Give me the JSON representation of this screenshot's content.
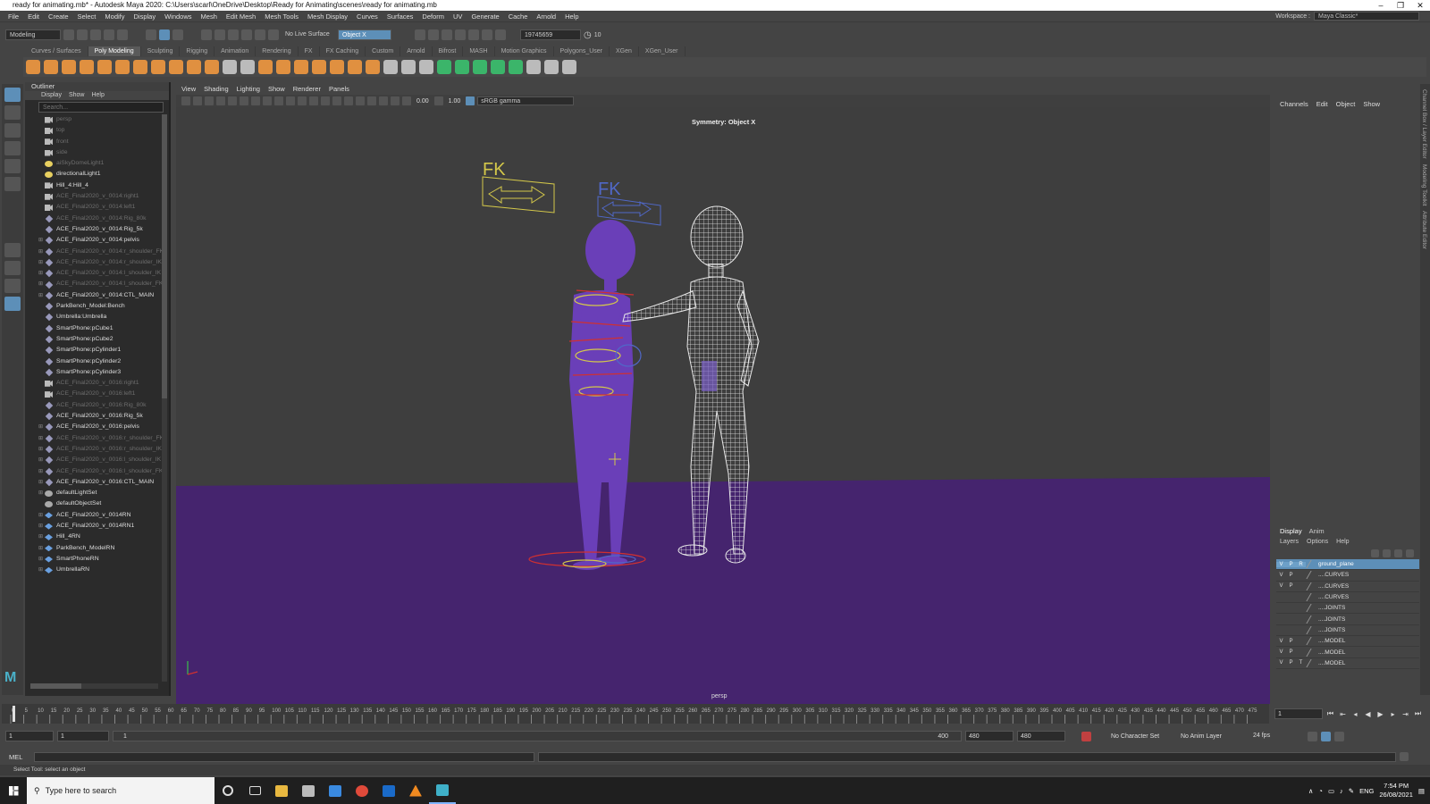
{
  "window": {
    "title": "ready for animating.mb* - Autodesk Maya 2020: C:\\Users\\scarl\\OneDrive\\Desktop\\Ready for Animating\\scenes\\ready for animating.mb",
    "min": "–",
    "max": "❐",
    "close": "✕"
  },
  "menubar": [
    "File",
    "Edit",
    "Create",
    "Select",
    "Modify",
    "Display",
    "Windows",
    "Mesh",
    "Edit Mesh",
    "Mesh Tools",
    "Mesh Display",
    "Curves",
    "Surfaces",
    "Deform",
    "UV",
    "Generate",
    "Cache",
    "Arnold",
    "Help"
  ],
  "workspace": {
    "label": "Workspace :",
    "value": "Maya Classic*"
  },
  "statusline": {
    "menuset": "Modeling",
    "live_surface": "No Live Surface",
    "symmetry": "Object X",
    "user_id": "19745659",
    "count": "10"
  },
  "shelf_tabs": [
    "Curves / Surfaces",
    "Poly Modeling",
    "Sculpting",
    "Rigging",
    "Animation",
    "Rendering",
    "FX",
    "FX Caching",
    "Custom",
    "Arnold",
    "Bifrost",
    "MASH",
    "Motion Graphics",
    "Polygons_User",
    "XGen",
    "XGen_User"
  ],
  "shelf_active": "Poly Modeling",
  "outliner": {
    "title": "Outliner",
    "menu": [
      "Display",
      "Show",
      "Help"
    ],
    "search_placeholder": "Search...",
    "items": [
      {
        "label": "persp",
        "icon": "cam",
        "dim": true,
        "exp": ""
      },
      {
        "label": "top",
        "icon": "cam",
        "dim": true,
        "exp": ""
      },
      {
        "label": "front",
        "icon": "cam",
        "dim": true,
        "exp": ""
      },
      {
        "label": "side",
        "icon": "cam",
        "dim": true,
        "exp": ""
      },
      {
        "label": "aiSkyDomeLight1",
        "icon": "lt",
        "dim": true,
        "exp": ""
      },
      {
        "label": "directionalLight1",
        "icon": "lt",
        "dim": false,
        "exp": ""
      },
      {
        "label": "Hill_4:Hill_4",
        "icon": "cam",
        "dim": false,
        "exp": ""
      },
      {
        "label": "ACE_Final2020_v_0014:right1",
        "icon": "cam",
        "dim": true,
        "exp": ""
      },
      {
        "label": "ACE_Final2020_v_0014:left1",
        "icon": "cam",
        "dim": true,
        "exp": ""
      },
      {
        "label": "ACE_Final2020_v_0014:Rig_80k",
        "icon": "xf",
        "dim": true,
        "exp": ""
      },
      {
        "label": "ACE_Final2020_v_0014:Rig_5k",
        "icon": "xf",
        "dim": false,
        "exp": ""
      },
      {
        "label": "ACE_Final2020_v_0014:pelvis",
        "icon": "xf",
        "dim": false,
        "exp": "⊞"
      },
      {
        "label": "ACE_Final2020_v_0014:r_shoulder_FK",
        "icon": "xf",
        "dim": true,
        "exp": "⊞"
      },
      {
        "label": "ACE_Final2020_v_0014:r_shoulder_IK",
        "icon": "xf",
        "dim": true,
        "exp": "⊞"
      },
      {
        "label": "ACE_Final2020_v_0014:l_shoulder_IK",
        "icon": "xf",
        "dim": true,
        "exp": "⊞"
      },
      {
        "label": "ACE_Final2020_v_0014:l_shoulder_FK",
        "icon": "xf",
        "dim": true,
        "exp": "⊞"
      },
      {
        "label": "ACE_Final2020_v_0014:CTL_MAIN",
        "icon": "xf",
        "dim": false,
        "exp": "⊞"
      },
      {
        "label": "ParkBench_Model:Bench",
        "icon": "xf",
        "dim": false,
        "exp": ""
      },
      {
        "label": "Umbrella:Umbrella",
        "icon": "xf",
        "dim": false,
        "exp": ""
      },
      {
        "label": "SmartPhone:pCube1",
        "icon": "xf",
        "dim": false,
        "exp": ""
      },
      {
        "label": "SmartPhone:pCube2",
        "icon": "xf",
        "dim": false,
        "exp": ""
      },
      {
        "label": "SmartPhone:pCylinder1",
        "icon": "xf",
        "dim": false,
        "exp": ""
      },
      {
        "label": "SmartPhone:pCylinder2",
        "icon": "xf",
        "dim": false,
        "exp": ""
      },
      {
        "label": "SmartPhone:pCylinder3",
        "icon": "xf",
        "dim": false,
        "exp": ""
      },
      {
        "label": "ACE_Final2020_v_0016:right1",
        "icon": "cam",
        "dim": true,
        "exp": ""
      },
      {
        "label": "ACE_Final2020_v_0016:left1",
        "icon": "cam",
        "dim": true,
        "exp": ""
      },
      {
        "label": "ACE_Final2020_v_0016:Rig_80k",
        "icon": "xf",
        "dim": true,
        "exp": ""
      },
      {
        "label": "ACE_Final2020_v_0016:Rig_5k",
        "icon": "xf",
        "dim": false,
        "exp": ""
      },
      {
        "label": "ACE_Final2020_v_0016:pelvis",
        "icon": "xf",
        "dim": false,
        "exp": "⊞"
      },
      {
        "label": "ACE_Final2020_v_0016:r_shoulder_FK",
        "icon": "xf",
        "dim": true,
        "exp": "⊞"
      },
      {
        "label": "ACE_Final2020_v_0016:r_shoulder_IK",
        "icon": "xf",
        "dim": true,
        "exp": "⊞"
      },
      {
        "label": "ACE_Final2020_v_0016:l_shoulder_IK",
        "icon": "xf",
        "dim": true,
        "exp": "⊞"
      },
      {
        "label": "ACE_Final2020_v_0016:l_shoulder_FK",
        "icon": "xf",
        "dim": true,
        "exp": "⊞"
      },
      {
        "label": "ACE_Final2020_v_0016:CTL_MAIN",
        "icon": "xf",
        "dim": false,
        "exp": "⊞"
      },
      {
        "label": "defaultLightSet",
        "icon": "set",
        "dim": false,
        "exp": "⊞"
      },
      {
        "label": "defaultObjectSet",
        "icon": "set",
        "dim": false,
        "exp": ""
      },
      {
        "label": "ACE_Final2020_v_0014RN",
        "icon": "ref",
        "dim": false,
        "exp": "⊞"
      },
      {
        "label": "ACE_Final2020_v_0014RN1",
        "icon": "ref",
        "dim": false,
        "exp": "⊞"
      },
      {
        "label": "Hill_4RN",
        "icon": "ref",
        "dim": false,
        "exp": "⊞"
      },
      {
        "label": "ParkBench_ModelRN",
        "icon": "ref",
        "dim": false,
        "exp": "⊞"
      },
      {
        "label": "SmartPhoneRN",
        "icon": "ref",
        "dim": false,
        "exp": "⊞"
      },
      {
        "label": "UmbrellaRN",
        "icon": "ref",
        "dim": false,
        "exp": "⊞"
      }
    ]
  },
  "viewport": {
    "menu": [
      "View",
      "Shading",
      "Lighting",
      "Show",
      "Renderer",
      "Panels"
    ],
    "exposure": "0.00",
    "gamma": "1.00",
    "color_space": "sRGB gamma",
    "symmetry_label": "Symmetry: Object X",
    "camera": "persp",
    "fk_label": "FK",
    "colors": {
      "floor": "#45246e",
      "bg": "#3e3e3e",
      "character": "#6a3fb8",
      "wire": "#e8e8e8"
    }
  },
  "channelbox": {
    "menu": [
      "Channels",
      "Edit",
      "Object",
      "Show"
    ]
  },
  "side_tabs": [
    "Channel Box / Layer Editor",
    "Modeling Toolkit",
    "Attribute Editor"
  ],
  "layers": {
    "tabs": [
      "Display",
      "Anim"
    ],
    "menu": [
      "Layers",
      "Options",
      "Help"
    ],
    "rows": [
      {
        "v": "V",
        "p": "P",
        "r": "R",
        "name": "ground_plane",
        "selected": true
      },
      {
        "v": "V",
        "p": "P",
        "r": "",
        "name": "....CURVES",
        "selected": false
      },
      {
        "v": "V",
        "p": "P",
        "r": "",
        "name": "....CURVES",
        "selected": false
      },
      {
        "v": "",
        "p": "",
        "r": "",
        "name": "....CURVES",
        "selected": false
      },
      {
        "v": "",
        "p": "",
        "r": "",
        "name": "....JOINTS",
        "selected": false
      },
      {
        "v": "",
        "p": "",
        "r": "",
        "name": "....JOINTS",
        "selected": false
      },
      {
        "v": "",
        "p": "",
        "r": "",
        "name": "....JOINTS",
        "selected": false
      },
      {
        "v": "V",
        "p": "P",
        "r": "",
        "name": "....MODEL",
        "selected": false
      },
      {
        "v": "V",
        "p": "P",
        "r": "",
        "name": "....MODEL",
        "selected": false
      },
      {
        "v": "V",
        "p": "P",
        "r": "T",
        "name": "....MODEL",
        "selected": false
      }
    ]
  },
  "timeslider": {
    "ticks": [
      "0",
      "5",
      "10",
      "15",
      "20",
      "25",
      "30",
      "35",
      "40",
      "45",
      "50",
      "55",
      "60",
      "65",
      "70",
      "75",
      "80",
      "85",
      "90",
      "95",
      "100",
      "105",
      "110",
      "115",
      "120",
      "125",
      "130",
      "135",
      "140",
      "145",
      "150",
      "155",
      "160",
      "165",
      "170",
      "175",
      "180",
      "185",
      "190",
      "195",
      "200",
      "205",
      "210",
      "215",
      "220",
      "225",
      "230",
      "235",
      "240",
      "245",
      "250",
      "255",
      "260",
      "265",
      "270",
      "275",
      "280",
      "285",
      "290",
      "295",
      "300",
      "305",
      "310",
      "315",
      "320",
      "325",
      "330",
      "335",
      "340",
      "345",
      "350",
      "355",
      "360",
      "365",
      "370",
      "375",
      "380",
      "385",
      "390",
      "395",
      "400",
      "405",
      "410",
      "415",
      "420",
      "425",
      "430",
      "435",
      "440",
      "445",
      "450",
      "455",
      "460",
      "465",
      "470",
      "475"
    ],
    "current_frame": "1"
  },
  "range": {
    "start": "1",
    "start2": "1",
    "slider_start": "1",
    "slider_end": "400",
    "end": "480",
    "end2": "480",
    "character_set": "No Character Set",
    "anim_layer": "No Anim Layer",
    "fps": "24 fps"
  },
  "mel": {
    "label": "MEL"
  },
  "helpline": "Select Tool: select an object",
  "taskbar": {
    "search": "Type here to search",
    "time": "7:54 PM",
    "date": "26/08/2021",
    "lang": "ENG"
  }
}
